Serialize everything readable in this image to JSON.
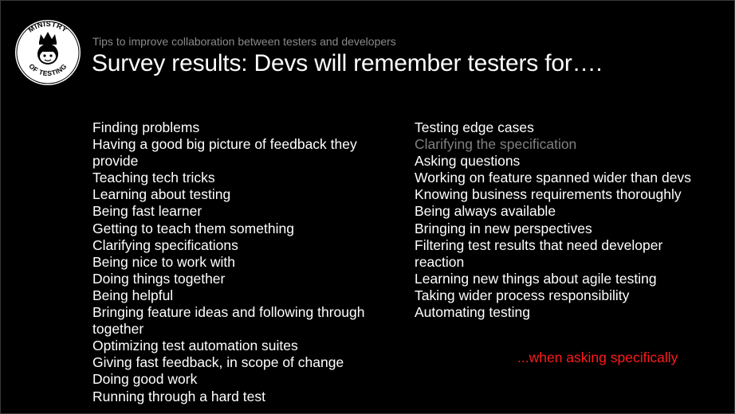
{
  "slide": {
    "subtitle": "Tips to improve collaboration between testers and developers",
    "title": "Survey results: Devs will remember testers for….",
    "logo": {
      "text_top": "MINISTRY",
      "text_bottom": "OF TESTING",
      "icon": "crown-face-icon"
    },
    "left_list": [
      "Finding problems",
      "Having a good big picture of feedback they provide",
      "Teaching tech tricks",
      "Learning about testing",
      "Being fast learner",
      "Getting to teach them something",
      "Clarifying specifications",
      "Being nice to work with",
      "Doing things together",
      "Being helpful",
      "Bringing feature ideas and following  through together",
      "Optimizing test automation suites",
      "Giving fast feedback, in scope of change",
      "Doing good work",
      "Running through a hard test"
    ],
    "right_list": [
      "Testing edge cases",
      "Clarifying the specification",
      "Asking questions",
      "Working on feature spanned wider than devs",
      "Knowing business requirements thoroughly",
      "Being always available",
      "Bringing in new perspectives",
      "Filtering test results that need developer reaction",
      "Learning new things about agile testing",
      "Taking wider process responsibility",
      "Automating testing"
    ],
    "dimmed_right_item_index": 1,
    "note": "...when asking specifically",
    "colors": {
      "background": "#000000",
      "text": "#ffffff",
      "subtitle": "#8a8a8a",
      "dimmed": "#808080",
      "note": "#ff1a1a"
    }
  }
}
